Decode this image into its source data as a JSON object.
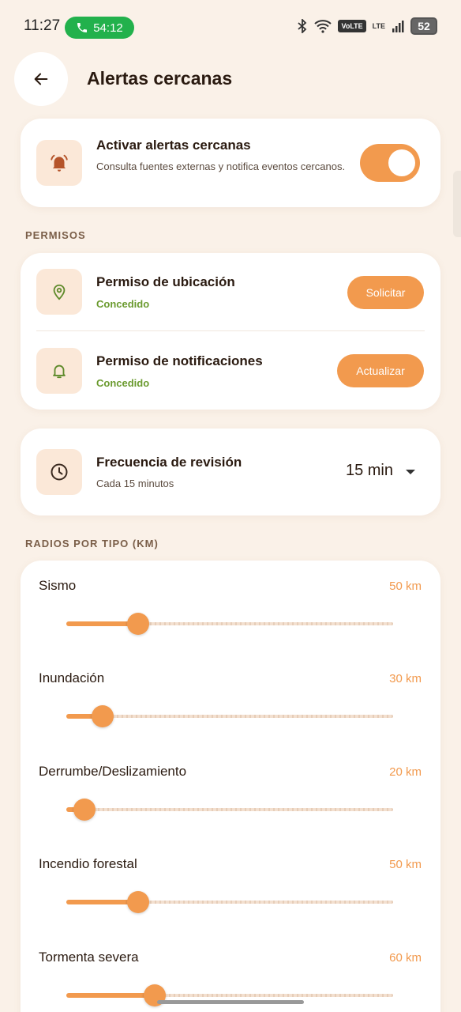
{
  "status_bar": {
    "time": "11:27",
    "call_timer": "54:12",
    "volte": "VoLTE",
    "lte": "LTE",
    "battery": "52"
  },
  "header": {
    "title": "Alertas cercanas"
  },
  "activate": {
    "title": "Activar alertas cercanas",
    "subtitle": "Consulta fuentes externas y notifica eventos cercanos.",
    "enabled": true
  },
  "permissions": {
    "section_label": "PERMISOS",
    "items": [
      {
        "title": "Permiso de ubicación",
        "status": "Concedido",
        "button": "Solicitar",
        "icon": "location-pin-icon"
      },
      {
        "title": "Permiso de notificaciones",
        "status": "Concedido",
        "button": "Actualizar",
        "icon": "bell-icon"
      }
    ]
  },
  "frequency": {
    "title": "Frecuencia de revisión",
    "subtitle": "Cada 15 minutos",
    "value": "15 min"
  },
  "radii": {
    "section_label": "RADIOS POR TIPO (KM)",
    "items": [
      {
        "name": "Sismo",
        "value_label": "50 km",
        "fraction": 0.22
      },
      {
        "name": "Inundación",
        "value_label": "30 km",
        "fraction": 0.11
      },
      {
        "name": "Derrumbe/Deslizamiento",
        "value_label": "20 km",
        "fraction": 0.055
      },
      {
        "name": "Incendio forestal",
        "value_label": "50 km",
        "fraction": 0.22
      },
      {
        "name": "Tormenta severa",
        "value_label": "60 km",
        "fraction": 0.27
      }
    ]
  },
  "colors": {
    "accent": "#f29a4e",
    "background": "#faf1e8",
    "granted": "#6a9a2e"
  }
}
